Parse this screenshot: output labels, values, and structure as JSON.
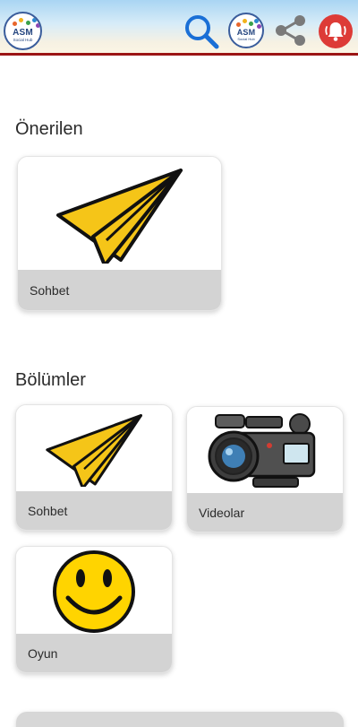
{
  "header": {
    "logo": {
      "title": "ASM",
      "subtitle": "Social Hub"
    },
    "profile_logo": {
      "title": "ASM",
      "subtitle": "Social Hub"
    },
    "icons": [
      "search-icon",
      "share-icon",
      "notification-bell-icon"
    ],
    "colors": {
      "accent_line": "#9b1414",
      "bell_bg": "#dd3b37",
      "search": "#1a6fd6"
    }
  },
  "recommended": {
    "title": "Önerilen",
    "items": [
      {
        "label": "Sohbet",
        "icon": "paper-plane"
      }
    ]
  },
  "sections": {
    "title": "Bölümler",
    "items": [
      {
        "label": "Sohbet",
        "icon": "paper-plane"
      },
      {
        "label": "Videolar",
        "icon": "video-camera"
      },
      {
        "label": "Oyun",
        "icon": "smiley-face"
      }
    ]
  }
}
